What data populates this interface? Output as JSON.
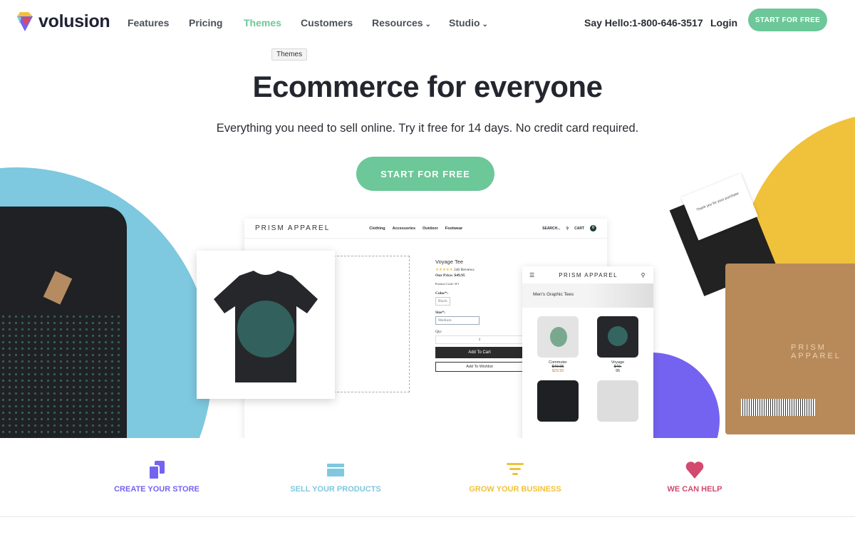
{
  "nav": {
    "logo": "volusion",
    "links": [
      {
        "label": "Features"
      },
      {
        "label": "Pricing"
      },
      {
        "label": "Themes",
        "active": true
      },
      {
        "label": "Customers"
      },
      {
        "label": "Resources",
        "dropdown": true
      },
      {
        "label": "Studio",
        "dropdown": true
      }
    ],
    "say_hello": "Say Hello:",
    "phone": "1-800-646-3517",
    "login": "Login",
    "cta": "START FOR FREE",
    "tooltip": "Themes"
  },
  "hero": {
    "title": "Ecommerce for everyone",
    "subtitle": "Everything you need to sell online. Try it free for 14 days. No credit card required.",
    "cta": "START FOR FREE"
  },
  "mockup": {
    "brand": "PRISM APPAREL",
    "links": [
      "Clothing",
      "Accessories",
      "Outdoor",
      "Footwear"
    ],
    "search": "SEARCH...",
    "cart": "CART",
    "cart_count": "0",
    "product": {
      "name": "Voyage Tee",
      "stars": "★★★★★",
      "reviews": "240 Reviews",
      "price": "Our Price: $49.95",
      "code": "Product Code: W1",
      "color_label": "Color*:",
      "color_value": "Black",
      "size_label": "Size*:",
      "size_value": "Medium",
      "qty_label": "Qty:",
      "qty_value": "1",
      "add_to_cart": "Add To Cart",
      "add_to_wishlist": "Add To Wishlist"
    },
    "mobile": {
      "brand": "PRISM APPAREL",
      "banner": "Men's Graphic Tees",
      "items": [
        {
          "name": "Commuter",
          "old_price": "$49.95",
          "price": "$29.95"
        },
        {
          "name": "Voyage",
          "old_price": "$49.",
          "price": "95"
        }
      ]
    },
    "box_text": "PRISM APPAREL",
    "card_text": "Thank you for your purchase"
  },
  "features": [
    {
      "label": "CREATE YOUR STORE",
      "color": "#7463f0",
      "icon": "pages-icon"
    },
    {
      "label": "SELL YOUR PRODUCTS",
      "color": "#7ec8e0",
      "icon": "card-icon"
    },
    {
      "label": "GROW YOUR BUSINESS",
      "color": "#f0c23b",
      "icon": "funnel-icon"
    },
    {
      "label": "WE CAN HELP",
      "color": "#d24a6e",
      "icon": "heart-icon"
    }
  ],
  "colors": {
    "accent": "#6cc799",
    "blue": "#7ec8e0",
    "yellow": "#f0c23b",
    "purple": "#7463f0"
  }
}
